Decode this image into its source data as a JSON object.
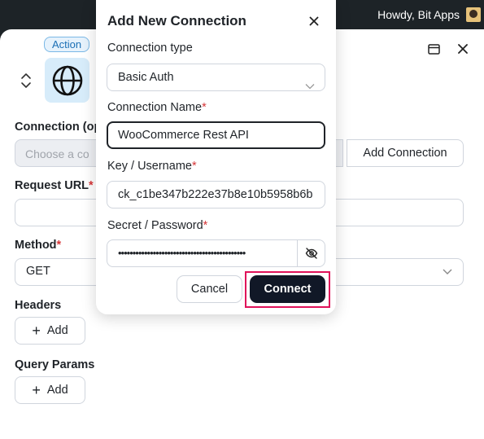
{
  "adminbar": {
    "howdy": "Howdy, Bit Apps"
  },
  "background": {
    "action_badge": "Action",
    "connection_label": "Connection (op",
    "connection_placeholder": "Choose a co",
    "add_connection_label": "Add Connection",
    "request_url_label": "Request URL",
    "method_label": "Method",
    "method_value": "GET",
    "headers_label": "Headers",
    "query_params_label": "Query Params",
    "add_label": "Add",
    "required_mark": "*"
  },
  "modal": {
    "title": "Add New Connection",
    "connection_type_label": "Connection type",
    "connection_type_value": "Basic Auth",
    "connection_name_label": "Connection Name",
    "connection_name_value": "WooCommerce Rest API",
    "key_label": "Key / Username",
    "key_value": "ck_c1be347b222e37b8e10b5958b6b",
    "secret_label": "Secret / Password",
    "secret_masked": "••••••••••••••••••••••••••••••••••••••••••••",
    "cancel_label": "Cancel",
    "connect_label": "Connect",
    "required_mark": "*"
  },
  "colors": {
    "accent": "#111827",
    "highlight": "#e0125a",
    "required": "#d63638",
    "badge": "#1b6fb5"
  },
  "icons": [
    "globe-icon",
    "sort-icon",
    "window-icon",
    "close-icon",
    "chevron-down-icon",
    "eye-off-icon",
    "plus-icon"
  ]
}
